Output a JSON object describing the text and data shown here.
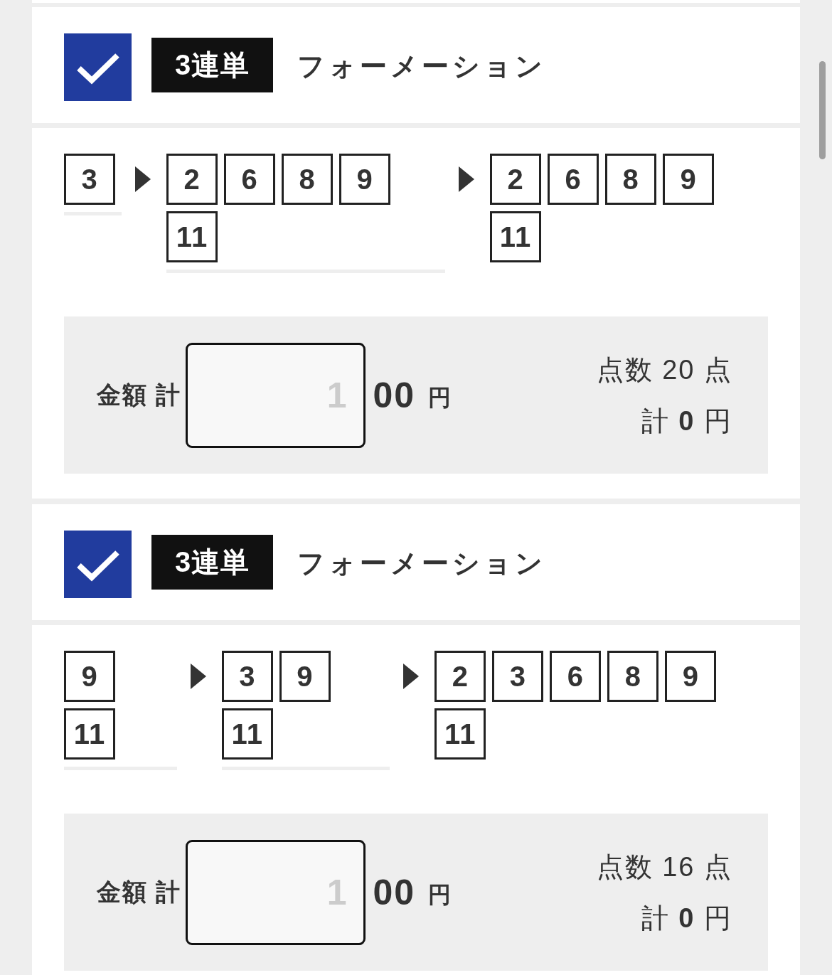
{
  "sections": [
    {
      "checked": true,
      "bet_type": "3連単",
      "method": "フォーメーション",
      "columns": [
        {
          "numbers": [
            "3"
          ]
        },
        {
          "numbers": [
            "2",
            "6",
            "8",
            "9",
            "11"
          ]
        },
        {
          "numbers": [
            "2",
            "6",
            "8",
            "9",
            "11"
          ]
        }
      ],
      "amount": {
        "label": "金額 計",
        "placeholder": "1",
        "suffix": "00",
        "unit": "円"
      },
      "summary": {
        "count": "点数 20 点",
        "total": "計 **0** 円"
      }
    },
    {
      "checked": true,
      "bet_type": "3連単",
      "method": "フォーメーション",
      "columns": [
        {
          "numbers": [
            "9",
            "11"
          ]
        },
        {
          "numbers": [
            "3",
            "9",
            "11"
          ]
        },
        {
          "numbers": [
            "2",
            "3",
            "6",
            "8",
            "9",
            "11"
          ]
        }
      ],
      "amount": {
        "label": "金額 計",
        "placeholder": "1",
        "suffix": "00",
        "unit": "円"
      },
      "summary": {
        "count": "点数 16 点",
        "total": "計 **0** 円"
      }
    }
  ]
}
